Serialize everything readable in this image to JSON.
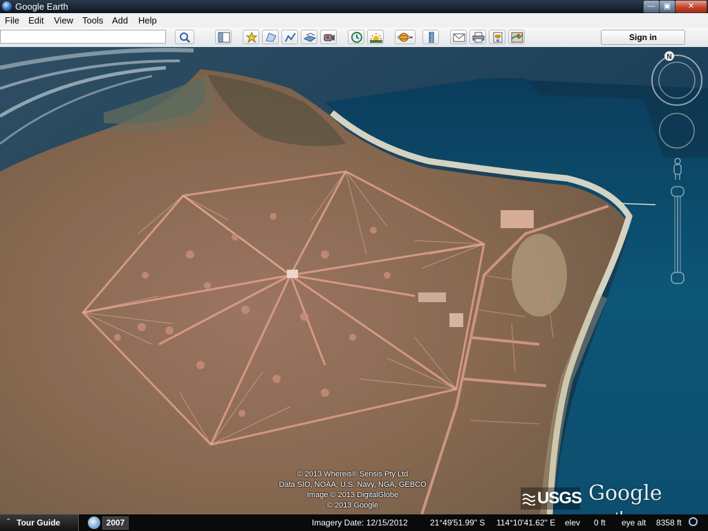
{
  "window": {
    "title": "Google Earth"
  },
  "menu": [
    {
      "label": "File"
    },
    {
      "label": "Edit"
    },
    {
      "label": "View"
    },
    {
      "label": "Tools"
    },
    {
      "label": "Add"
    },
    {
      "label": "Help"
    }
  ],
  "toolbar": {
    "search_value": "",
    "buttons": [
      "search-icon",
      "sidebar-icon",
      "placemark-icon",
      "polygon-icon",
      "path-icon",
      "overlay-icon",
      "record-tour-icon",
      "historical-imagery-icon",
      "sunlight-icon",
      "planet-icon",
      "ruler-icon",
      "email-icon",
      "print-icon",
      "save-image-icon",
      "view-in-maps-icon"
    ],
    "sign_in_label": "Sign in"
  },
  "map": {
    "north_label": "N",
    "attribution": [
      "© 2013 Whereis® Sensis Pty Ltd",
      "Data SIO, NOAA, U.S. Navy, NGA, GEBCO",
      "Image © 2013 DigitalGlobe",
      "© 2013 Google"
    ],
    "usgs_label": "USGS",
    "logo": {
      "google": "Google",
      "earth": "earth"
    }
  },
  "status": {
    "tour_guide_label": "Tour Guide",
    "historical_year": "2007",
    "imagery_date": "Imagery Date: 12/15/2012",
    "latitude": "21°49'51.99\" S",
    "longitude": "114°10'41.62\" E",
    "elev_label": "elev",
    "elev_value": "0 ft",
    "eye_alt_label": "eye alt",
    "eye_alt_value": "8358 ft"
  },
  "colors": {
    "ocean_deep": "#0b3d5c",
    "land": "#8a6a55",
    "road": "#d49a84"
  }
}
